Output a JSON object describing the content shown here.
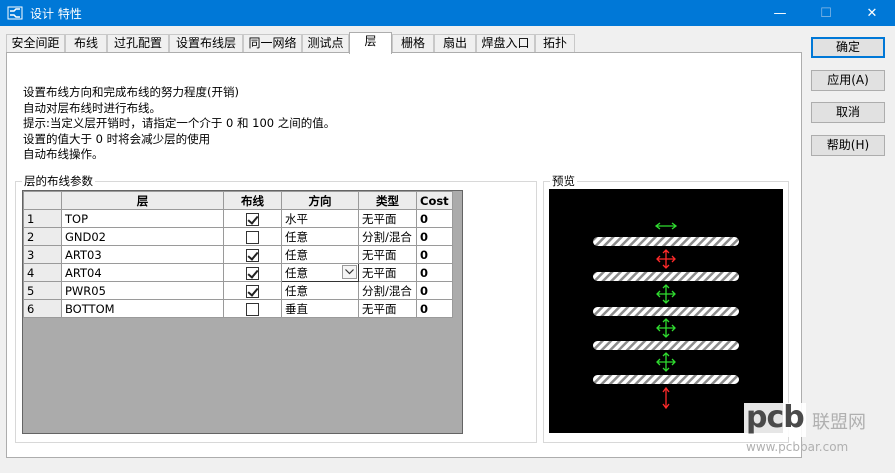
{
  "window": {
    "title": "设计 特性",
    "minimize": "—",
    "maximize": "☐",
    "close": "✕"
  },
  "tabs": [
    "安全间距",
    "布线",
    "过孔配置",
    "设置布线层",
    "同一网络",
    "测试点",
    "层",
    "栅格",
    "扇出",
    "焊盘入口",
    "拓扑"
  ],
  "active_tab": "层",
  "description": [
    "设置布线方向和完成布线的努力程度(开销)",
    "自动对层布线时进行布线。",
    "提示:当定义层开销时，请指定一个介于 0 和 100 之间的值。",
    "设置的值大于 0 时将会减少层的使用",
    "自动布线操作。"
  ],
  "layer_group_label": "层的布线参数",
  "preview_label": "预览",
  "table": {
    "headers": [
      "",
      "层",
      "布线",
      "方向",
      "类型",
      "Cost"
    ],
    "rows": [
      {
        "num": "1",
        "layer": "TOP",
        "routed": true,
        "direction": "水平",
        "type": "无平面",
        "cost": "0"
      },
      {
        "num": "2",
        "layer": "GND02",
        "routed": false,
        "direction": "任意",
        "type": "分割/混合",
        "cost": "0"
      },
      {
        "num": "3",
        "layer": "ART03",
        "routed": true,
        "direction": "任意",
        "type": "无平面",
        "cost": "0"
      },
      {
        "num": "4",
        "layer": "ART04",
        "routed": true,
        "direction": "任意",
        "type": "无平面",
        "cost": "0"
      },
      {
        "num": "5",
        "layer": "PWR05",
        "routed": true,
        "direction": "任意",
        "type": "分割/混合",
        "cost": "0"
      },
      {
        "num": "6",
        "layer": "BOTTOM",
        "routed": false,
        "direction": "垂直",
        "type": "无平面",
        "cost": "0"
      }
    ]
  },
  "buttons": {
    "ok": "确定",
    "apply": "应用(A)",
    "cancel": "取消",
    "help": "帮助(H)"
  },
  "watermark": {
    "brand": "pcb",
    "cn": "联盟网",
    "url": "www.pcbbar.com"
  },
  "colors": {
    "titlebar": "#0078d7",
    "preview_bg": "#000000",
    "arrow_green": "#2fdc2f",
    "arrow_red": "#ff2a2a"
  },
  "preview_arrows": [
    "horizontal-green",
    "omni-red",
    "omni-green",
    "omni-green",
    "omni-green",
    "vertical-red"
  ]
}
